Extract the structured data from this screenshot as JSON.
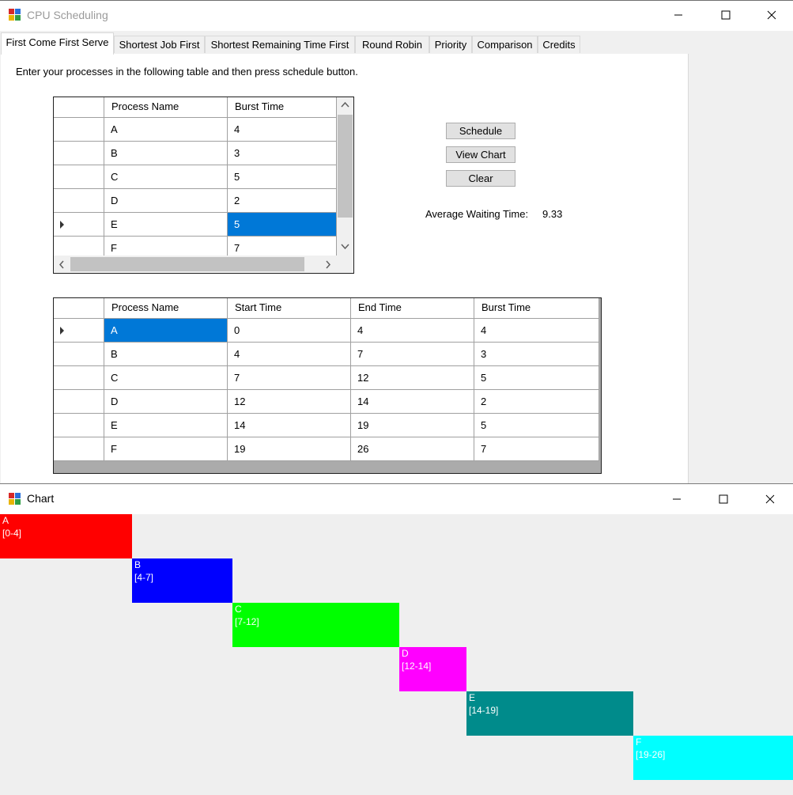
{
  "main_window": {
    "title": "CPU Scheduling",
    "tabs": [
      {
        "label": "First Come First Serve",
        "active": true
      },
      {
        "label": "Shortest Job First",
        "active": false
      },
      {
        "label": "Shortest Remaining Time First",
        "active": false
      },
      {
        "label": "Round Robin",
        "active": false
      },
      {
        "label": "Priority",
        "active": false
      },
      {
        "label": "Comparison",
        "active": false
      },
      {
        "label": "Credits",
        "active": false
      }
    ],
    "instruction": "Enter your processes in the following table and then press schedule button.",
    "input_table": {
      "columns": [
        "Process Name",
        "Burst Time"
      ],
      "rows": [
        [
          "A",
          "4"
        ],
        [
          "B",
          "3"
        ],
        [
          "C",
          "5"
        ],
        [
          "D",
          "2"
        ],
        [
          "E",
          "5"
        ],
        [
          "F",
          "7"
        ]
      ],
      "current_row": 4,
      "selected_cell": [
        4,
        1
      ]
    },
    "buttons": {
      "schedule": "Schedule",
      "view_chart": "View Chart",
      "clear": "Clear"
    },
    "avg_wait": {
      "label": "Average Waiting Time:",
      "value": "9.33"
    },
    "result_table": {
      "columns": [
        "Process Name",
        "Start Time",
        "End Time",
        "Burst Time"
      ],
      "rows": [
        [
          "A",
          "0",
          "4",
          "4"
        ],
        [
          "B",
          "4",
          "7",
          "3"
        ],
        [
          "C",
          "7",
          "12",
          "5"
        ],
        [
          "D",
          "12",
          "14",
          "2"
        ],
        [
          "E",
          "14",
          "19",
          "5"
        ],
        [
          "F",
          "19",
          "26",
          "7"
        ]
      ],
      "current_row": 0,
      "selected_cell": [
        0,
        0
      ]
    }
  },
  "chart_window": {
    "title": "Chart",
    "bars": [
      {
        "name": "A",
        "range": "[0-4]",
        "start": 0,
        "end": 4,
        "color": "#ff0000"
      },
      {
        "name": "B",
        "range": "[4-7]",
        "start": 4,
        "end": 7,
        "color": "#0000ff"
      },
      {
        "name": "C",
        "range": "[7-12]",
        "start": 7,
        "end": 12,
        "color": "#00ff00"
      },
      {
        "name": "D",
        "range": "[12-14]",
        "start": 12,
        "end": 14,
        "color": "#ff00ff"
      },
      {
        "name": "E",
        "range": "[14-19]",
        "start": 14,
        "end": 19,
        "color": "#008b8b"
      },
      {
        "name": "F",
        "range": "[19-26]",
        "start": 19,
        "end": 26,
        "color": "#00ffff"
      }
    ]
  },
  "colors": {
    "selection": "#0078d7",
    "button_face": "#e1e1e1"
  }
}
